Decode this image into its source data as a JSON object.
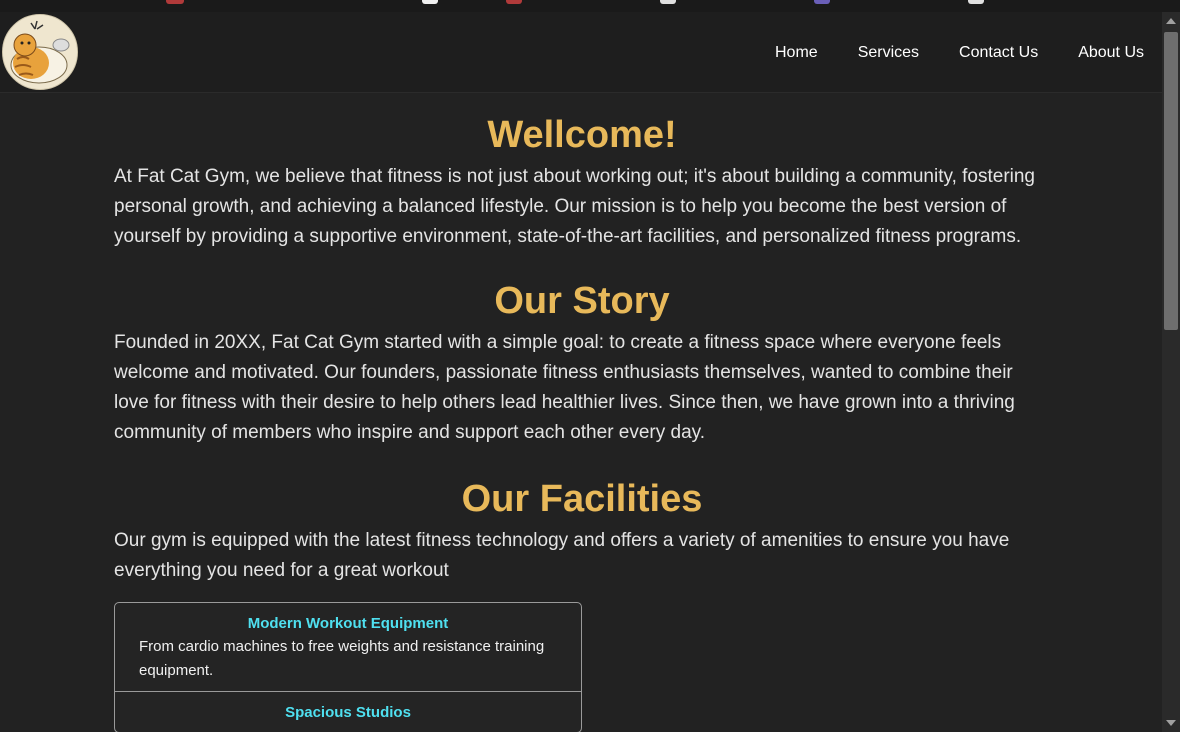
{
  "nav": {
    "items": [
      {
        "label": "Home"
      },
      {
        "label": "Services"
      },
      {
        "label": "Contact Us"
      },
      {
        "label": "About Us"
      }
    ]
  },
  "welcome": {
    "title": "Wellcome!",
    "text": "At Fat Cat Gym, we believe that fitness is not just about working out; it's about building a community, fostering personal growth, and achieving a balanced lifestyle. Our mission is to help you become the best version of yourself by providing a supportive environment, state-of-the-art facilities, and personalized fitness programs."
  },
  "story": {
    "title": "Our Story",
    "text": "Founded in 20XX, Fat Cat Gym started with a simple goal: to create a fitness space where everyone feels welcome and motivated. Our founders, passionate fitness enthusiasts themselves, wanted to combine their love for fitness with their desire to help others lead healthier lives. Since then, we have grown into a thriving community of members who inspire and support each other every day."
  },
  "facilities": {
    "title": "Our Facilities",
    "text": "Our gym is equipped with the latest fitness technology and offers a variety of amenities to ensure you have everything you need for a great workout",
    "items": [
      {
        "title": "Modern Workout Equipment",
        "desc": "From cardio machines to free weights and resistance training equipment."
      },
      {
        "title": "Spacious Studios",
        "desc": ""
      }
    ]
  },
  "colors": {
    "heading": "#e8b95a",
    "facility_title": "#4fe0f0",
    "background": "#222222"
  },
  "icons": {
    "logo": "fat-cat-logo-icon",
    "scroll_up": "scroll-up-arrow-icon",
    "scroll_down": "scroll-down-arrow-icon"
  }
}
